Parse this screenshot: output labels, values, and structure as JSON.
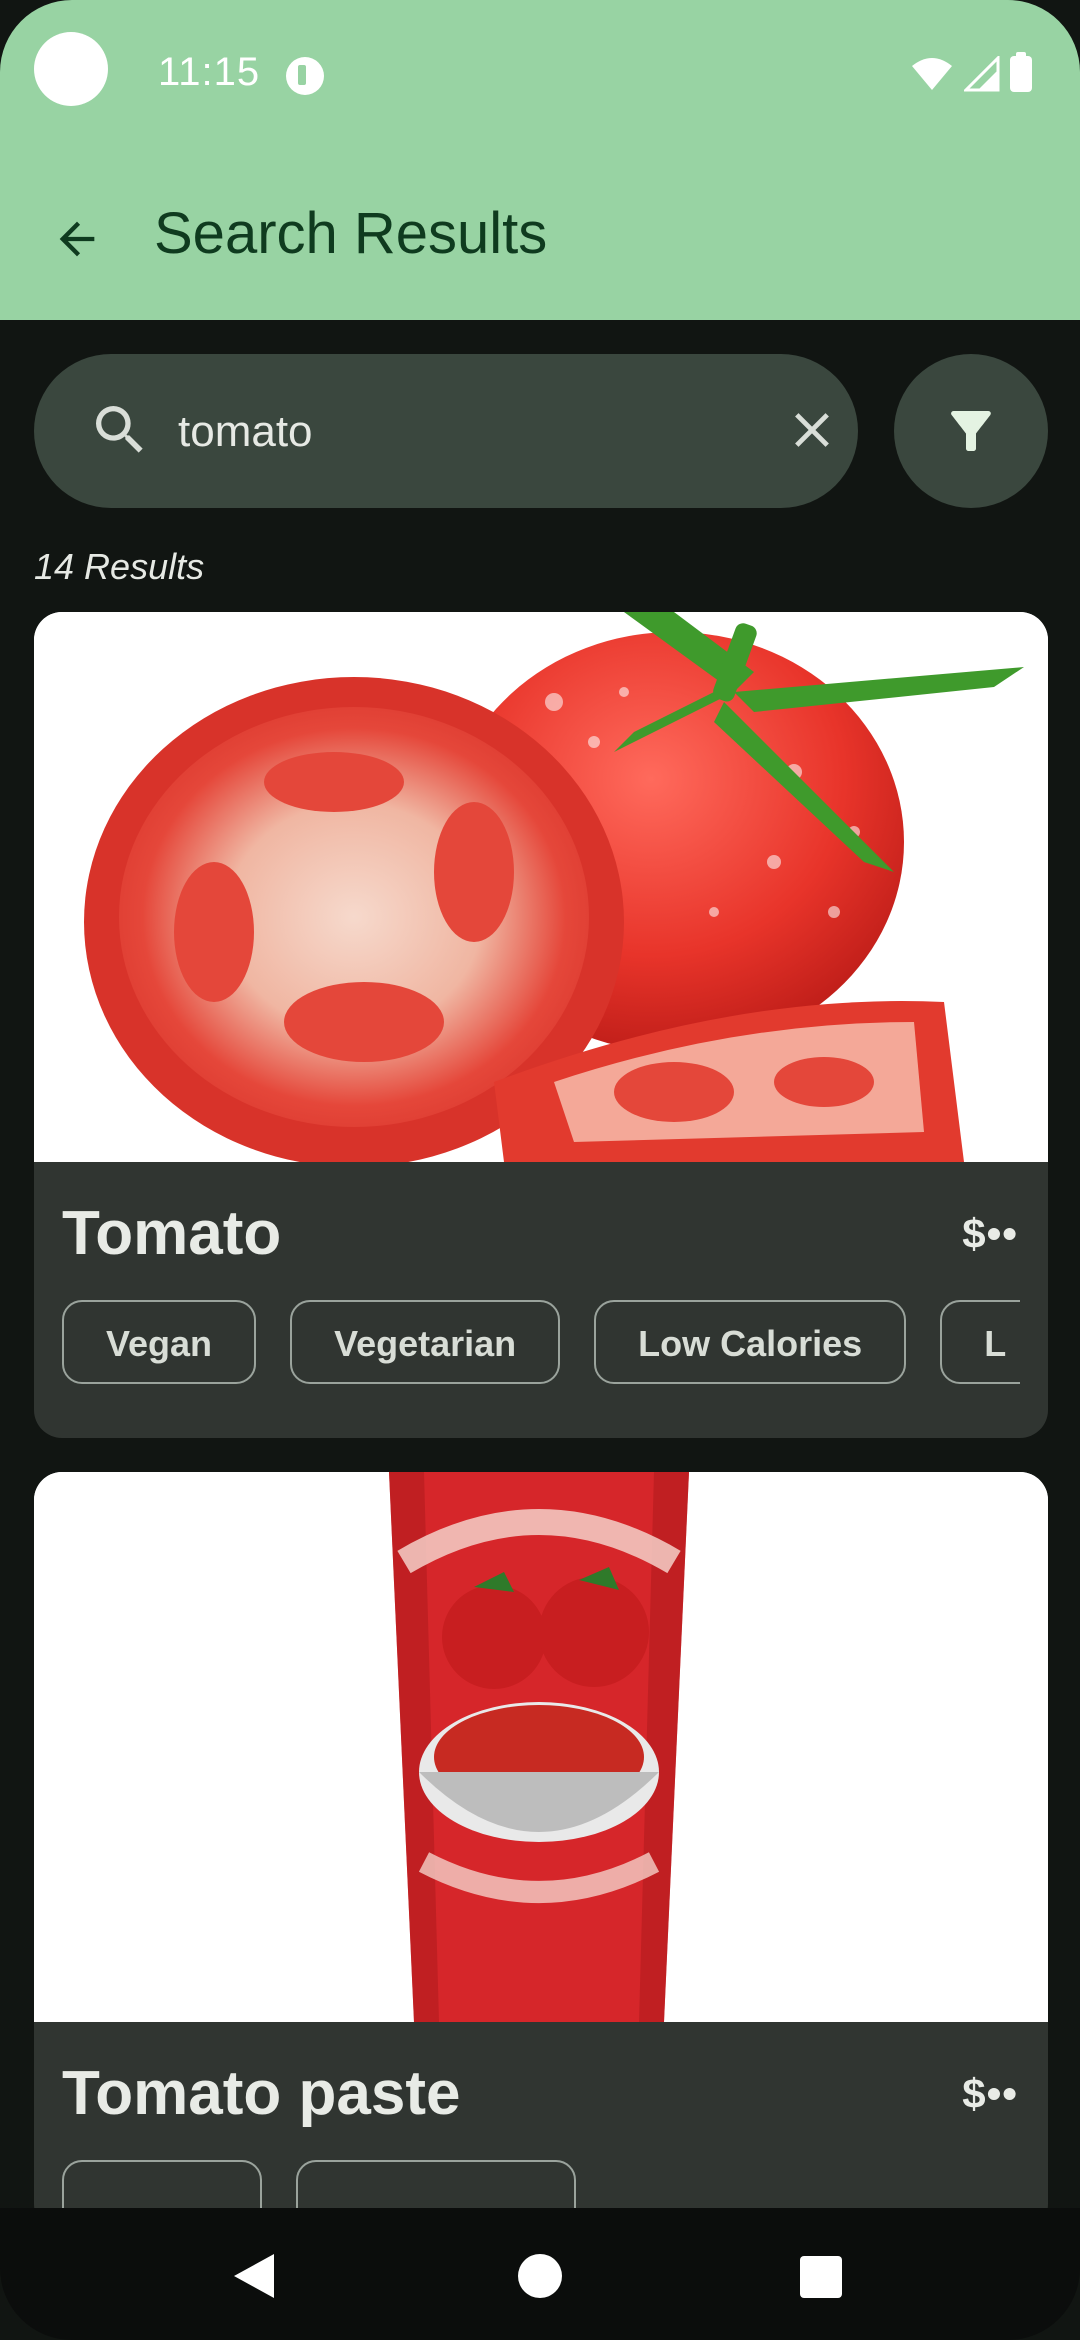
{
  "status_bar": {
    "time": "11:15"
  },
  "app_bar": {
    "title": "Search Results",
    "back_icon": "arrow-back-icon"
  },
  "search": {
    "value": "tomato",
    "placeholder": "",
    "search_icon": "search-icon",
    "clear_icon": "close-icon",
    "filter_icon": "filter-icon"
  },
  "results": {
    "count_label": "14 Results",
    "items": [
      {
        "name": "Tomato",
        "price": "$••",
        "tags": [
          "Vegan",
          "Vegetarian",
          "Low Calories",
          "L"
        ]
      },
      {
        "name": "Tomato paste",
        "price": "$••",
        "tags": [
          "",
          ""
        ]
      }
    ]
  },
  "colors": {
    "app_bar_bg": "#98d3a3",
    "title_text": "#0f3b1f",
    "screen_bg": "#111512",
    "search_bg": "#3a473e",
    "card_bg": "#303531"
  },
  "nav_bar": {
    "back_icon": "nav-back-icon",
    "home_icon": "nav-home-icon",
    "recents_icon": "nav-recents-icon"
  }
}
